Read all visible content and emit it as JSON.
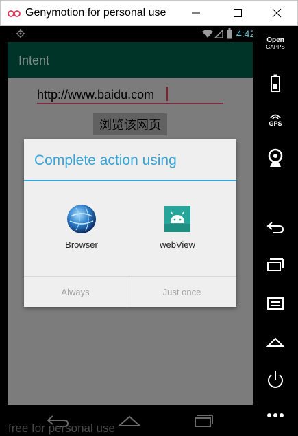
{
  "window": {
    "title": "Genymotion for personal use",
    "minimize_icon": "minimize-icon",
    "maximize_icon": "maximize-icon",
    "close_icon": "close-icon"
  },
  "status_bar": {
    "time": "4:42",
    "icons": [
      "location-target-icon",
      "wifi-icon",
      "signal-icon",
      "battery-icon"
    ],
    "time_color": "#63c4ce"
  },
  "app_bar": {
    "title": "Intent",
    "background": "#013429"
  },
  "main": {
    "url_input_value": "http://www.baidu.com",
    "browse_button_label": "浏览该网页"
  },
  "dialog": {
    "title": "Complete action using",
    "accent_color": "#35a4d8",
    "apps": [
      {
        "label": "Browser",
        "icon": "browser-globe-icon"
      },
      {
        "label": "webView",
        "icon": "android-app-icon"
      }
    ],
    "actions": {
      "always_label": "Always",
      "just_once_label": "Just once"
    }
  },
  "nav_bar": {
    "icons": [
      "back-icon",
      "home-icon",
      "recent-apps-icon"
    ]
  },
  "watermark": "free for personal use",
  "sidebar": {
    "gapps_label_line1": "Open",
    "gapps_label_line2": "GAPPS",
    "gps_label": "GPS",
    "icons": [
      "open-gapps-icon",
      "battery-icon",
      "gps-icon",
      "webcam-icon",
      "back-icon",
      "recent-apps-icon",
      "menu-icon",
      "home-icon",
      "power-icon",
      "more-icon"
    ]
  }
}
